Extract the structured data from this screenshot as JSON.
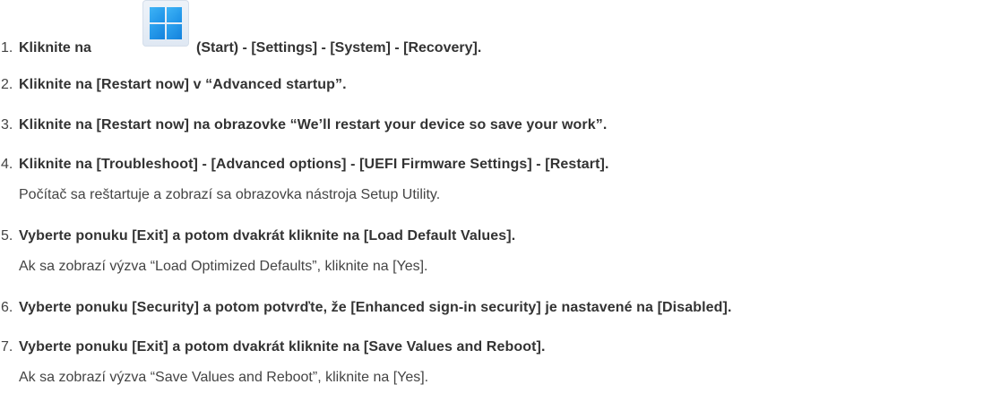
{
  "steps": [
    {
      "number": "1.",
      "text_before_icon": "Kliknite na",
      "icon": "windows-start-icon",
      "text_after_icon": "(Start) - [Settings] - [System] - [Recovery]."
    },
    {
      "number": "2.",
      "text": "Kliknite na [Restart now] v “Advanced startup”."
    },
    {
      "number": "3.",
      "text": "Kliknite na [Restart now] na obrazovke “We’ll restart your device so save your work”."
    },
    {
      "number": "4.",
      "text": "Kliknite na [Troubleshoot] - [Advanced options] - [UEFI Firmware Settings] - [Restart].",
      "note": "Počítač sa reštartuje a zobrazí sa obrazovka nástroja Setup Utility."
    },
    {
      "number": "5.",
      "text": "Vyberte ponuku [Exit] a potom dvakrát kliknite na [Load Default Values].",
      "note": "Ak sa zobrazí výzva “Load Optimized Defaults”, kliknite na [Yes]."
    },
    {
      "number": "6.",
      "text": "Vyberte ponuku [Security] a potom potvrďte, že [Enhanced sign-in security] je nastavené na [Disabled]."
    },
    {
      "number": "7.",
      "text": "Vyberte ponuku [Exit] a potom dvakrát kliknite na [Save Values and Reboot].",
      "note": "Ak sa zobrazí výzva “Save Values and Reboot”, kliknite na [Yes]."
    }
  ],
  "colors": {
    "text": "#333333",
    "numbers": "#444444",
    "icon_blue": "#1a8fe6",
    "icon_background": "#e6edf6"
  }
}
